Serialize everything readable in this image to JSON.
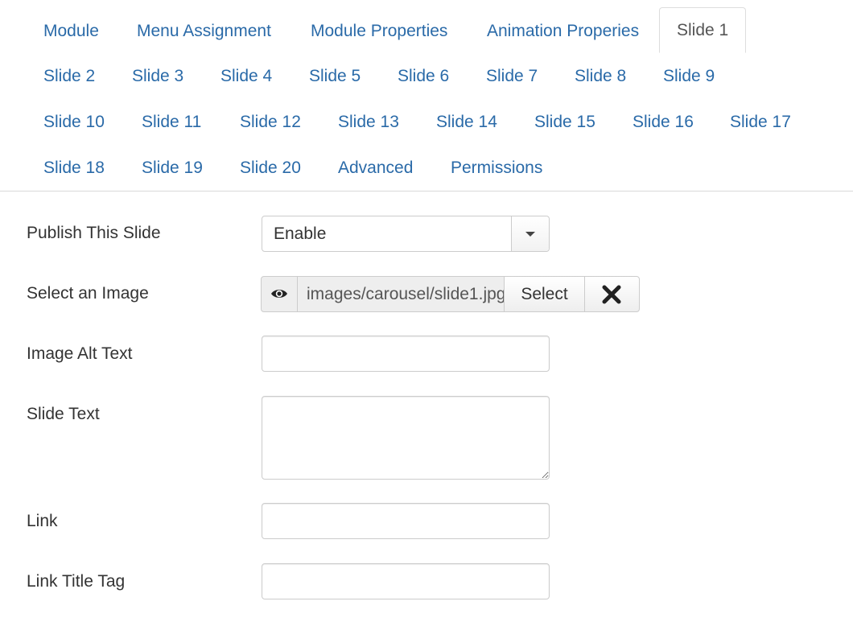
{
  "tabs": {
    "row1": [
      "Module",
      "Menu Assignment",
      "Module Properties",
      "Animation Properies",
      "Slide 1"
    ],
    "row2": [
      "Slide 2",
      "Slide 3",
      "Slide 4",
      "Slide 5",
      "Slide 6",
      "Slide 7",
      "Slide 8",
      "Slide 9"
    ],
    "row3": [
      "Slide 10",
      "Slide 11",
      "Slide 12",
      "Slide 13",
      "Slide 14",
      "Slide 15",
      "Slide 16",
      "Slide 17"
    ],
    "row4": [
      "Slide 18",
      "Slide 19",
      "Slide 20",
      "Advanced",
      "Permissions"
    ],
    "active": "Slide 1"
  },
  "form": {
    "publish": {
      "label": "Publish This Slide",
      "value": "Enable"
    },
    "image": {
      "label": "Select an Image",
      "path": "images/carousel/slide1.jpg",
      "select_label": "Select",
      "preview_icon": "eye-icon",
      "clear_icon": "close-icon"
    },
    "alt_text": {
      "label": "Image Alt Text",
      "value": ""
    },
    "slide_text": {
      "label": "Slide Text",
      "value": ""
    },
    "link": {
      "label": "Link",
      "value": ""
    },
    "link_title": {
      "label": "Link Title Tag",
      "value": ""
    }
  },
  "colors": {
    "tab_link": "#2a6aa8",
    "border": "#cccccc"
  }
}
